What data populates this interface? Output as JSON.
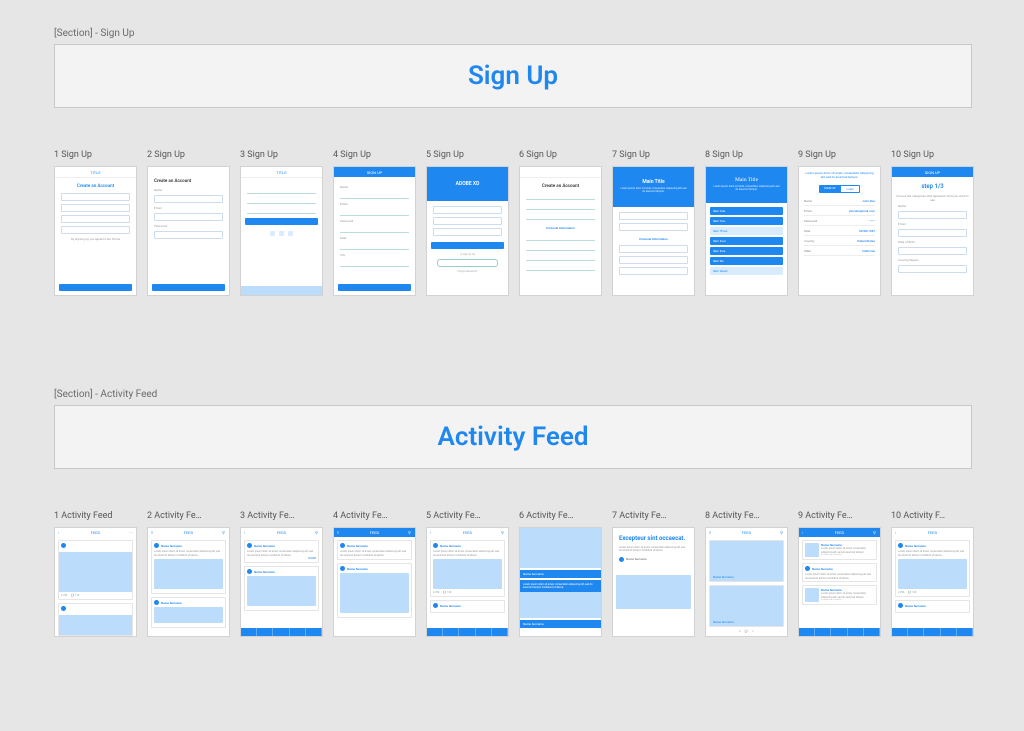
{
  "sections": {
    "signup": {
      "label": "[Section] - Sign Up",
      "title": "Sign Up",
      "headers": {
        "title": "TITLE",
        "signup": "SIGN UP",
        "feed": "FEED"
      },
      "content": {
        "createAccount": "Create an Account",
        "adobeXd": "ADOBE XD",
        "mainTitle": "Main Title",
        "step": "step 1/3",
        "stepSub": "Choose the categories that represent what you want to see",
        "loremShort": "Lorem ipsum dolor sit amet, consectetur adipiscing elit, sed do eiusmod tempor.",
        "signUpVia": "or sign up via",
        "forgot": "Forgot password?",
        "login": "Login",
        "personal": "Personal Information",
        "agree": "By signing up you agree to the Terms",
        "fields": {
          "name": "Name",
          "john": "John Doe",
          "email": "johndoe@mail.com",
          "password": "password",
          "pwDots": "••••••",
          "date": "05/08/1987",
          "country": "United States",
          "state": "California",
          "city": "City"
        }
      },
      "thumbs": [
        "1 Sign Up",
        "2 Sign Up",
        "3 Sign Up",
        "4 Sign Up",
        "5 Sign Up",
        "6 Sign Up",
        "7 Sign Up",
        "8 Sign Up",
        "9 Sign Up",
        "10 Sign Up"
      ]
    },
    "activity": {
      "label": "[Section] - Activity Feed",
      "title": "Activity Feed",
      "content": {
        "feed": "FEED",
        "name": "Name Surname",
        "excepteur": "Excepteur sint occaecat.",
        "lorem": "Lorem ipsum dolor sit amet, consectetur adipiscing elit, sed do eiusmod tempor incididunt ut labore.",
        "like": "256",
        "comment": "120",
        "share": "SHARE"
      },
      "thumbs": [
        "1 Activity Feed",
        "2 Activity Fe…",
        "3 Activity Fe…",
        "4 Activity Fe…",
        "5 Activity Fe…",
        "6 Activity Fe…",
        "7 Activity Fe…",
        "8 Activity Fe…",
        "9 Activity Fe…",
        "10 Activity F…"
      ]
    }
  }
}
